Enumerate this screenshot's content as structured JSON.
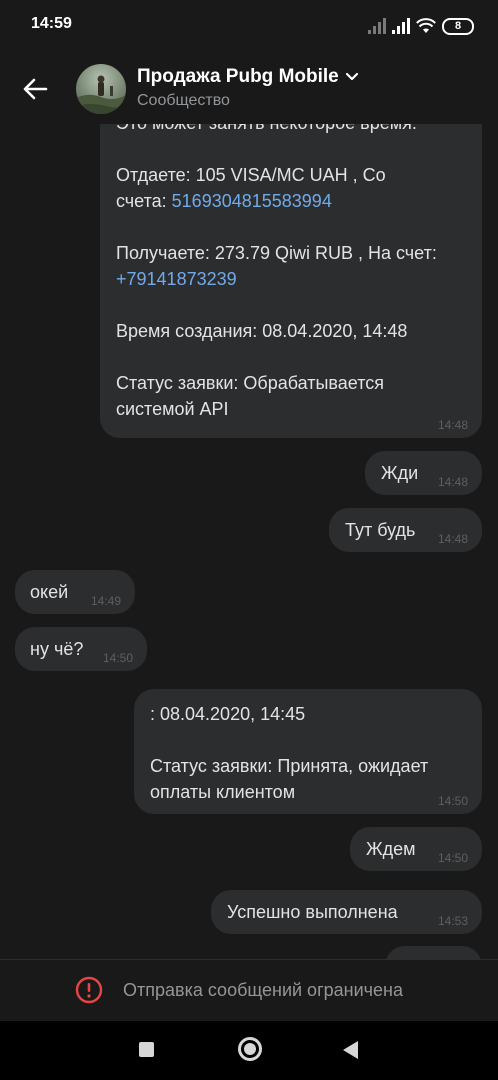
{
  "status_bar": {
    "time": "14:59",
    "battery": "8"
  },
  "header": {
    "title": "Продажа Pubg Mobile",
    "subtitle": "Сообщество"
  },
  "messages": [
    {
      "id": 1,
      "side": "out",
      "partial_top": "Это может занять некоторое время.",
      "lines_a": "Отдаете: 105 VISA/MC UAH , Со\nсчета: ",
      "link_a": "5169304815583994",
      "lines_b": "Получаете: 273.79 Qiwi RUB , На счет:\n",
      "link_b": "+79141873239",
      "lines_c": "Время создания: 08.04.2020, 14:48\n\nСтатус заявки: Обрабатывается\nсистемой API",
      "time": "14:48"
    },
    {
      "id": 2,
      "side": "out",
      "text": "Жди",
      "time": "14:48"
    },
    {
      "id": 3,
      "side": "out",
      "text": "Тут будь",
      "time": "14:48"
    },
    {
      "id": 4,
      "side": "in",
      "text": "окей",
      "time": "14:49"
    },
    {
      "id": 5,
      "side": "in",
      "text": "ну чё?",
      "time": "14:50"
    },
    {
      "id": 6,
      "side": "out",
      "text": ": 08.04.2020, 14:45\n\nСтатус заявки: Принята, ожидает\nоплаты клиентом",
      "time": "14:50"
    },
    {
      "id": 7,
      "side": "out",
      "text": "Ждем",
      "time": "14:50"
    },
    {
      "id": 8,
      "side": "out",
      "text": "Успешно выполнена",
      "time": "14:53"
    }
  ],
  "footer": {
    "text": "Отправка сообщений ограничена"
  },
  "colors": {
    "background": "#19191a",
    "bubble": "#2c2d2e",
    "link": "#71aaeb",
    "warning": "#e64646"
  },
  "icons": [
    "back-arrow-icon",
    "chevron-down-icon",
    "warning-icon",
    "signal-icon",
    "wifi-icon"
  ]
}
